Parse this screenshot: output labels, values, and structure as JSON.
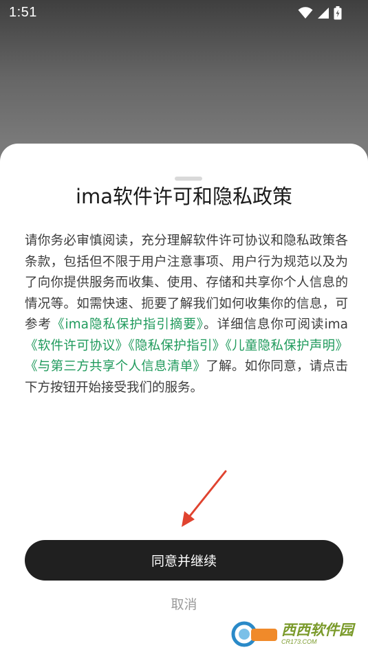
{
  "status_bar": {
    "time": "1:51",
    "icons": [
      "wifi-icon",
      "signal-icon",
      "battery-icon"
    ]
  },
  "dialog": {
    "title": "ima软件许可和隐私政策",
    "body": {
      "intro": "请你务必审慎阅读，充分理解软件许可协议和隐私政策各条款，包括但不限于用户注意事项、用户行为规范以及为了向你提供服务而收集、使用、存储和共享你个人信息的情况等。如需快速、扼要了解我们如何收集你的信息，可参考",
      "link_summary": "《ima隐私保护指引摘要》",
      "mid": "。详细信息你可阅读ima",
      "link_license": "《软件许可协议》",
      "link_privacy": "《隐私保护指引》",
      "link_children": "《儿童隐私保护声明》",
      "link_third_party": "《与第三方共享个人信息清单》",
      "outro": "了解。如你同意，请点击下方按钮开始接受我们的服务。"
    },
    "agree_button": "同意并继续",
    "cancel_button": "取消"
  },
  "watermark": {
    "brand_cn": "西西软件园",
    "brand_en": "CR173.COM"
  },
  "colors": {
    "link": "#1f9a5c",
    "button_bg": "#202020",
    "arrow": "#e0432f"
  }
}
